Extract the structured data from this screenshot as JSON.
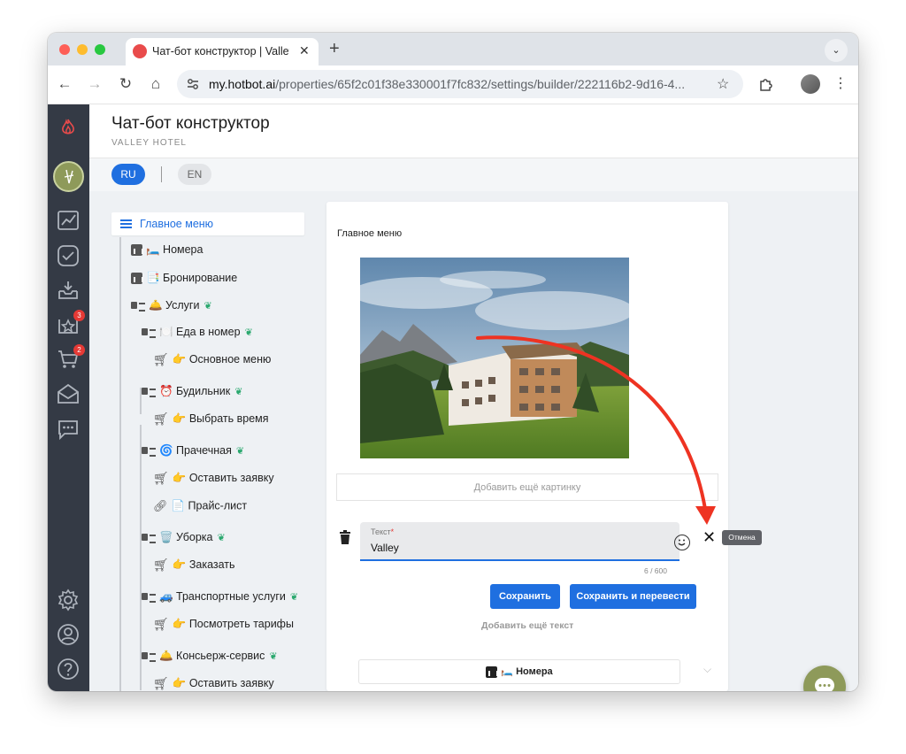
{
  "browser": {
    "tab_title": "Чат-бот конструктор | Valley",
    "url_host": "my.hotbot.ai",
    "url_path": "/properties/65f2c01f38e330001f7fc832/settings/builder/222116b2-9d16-4..."
  },
  "sidebar": {
    "badges": {
      "reviews": "3",
      "cart": "2"
    }
  },
  "header": {
    "title": "Чат-бот конструктор",
    "subtitle": "VALLEY HOTEL"
  },
  "languages": {
    "ru": "RU",
    "en": "EN"
  },
  "tree": {
    "main_menu": "Главное меню",
    "items": [
      {
        "label": "🛏️ Номера"
      },
      {
        "label": "📑 Бронирование"
      },
      {
        "label": "🛎️ Услуги"
      },
      {
        "label": "🍽️ Еда в номер"
      },
      {
        "label": "👉 Основное меню"
      },
      {
        "label": "⏰ Будильник"
      },
      {
        "label": "👉 Выбрать время"
      },
      {
        "label": "🌀 Прачечная"
      },
      {
        "label": "👉 Оставить заявку"
      },
      {
        "label": "📄 Прайс-лист"
      },
      {
        "label": "🗑️ Уборка"
      },
      {
        "label": "👉 Заказать"
      },
      {
        "label": "🚙 Транспортные услуги"
      },
      {
        "label": "👉 Посмотреть тарифы"
      },
      {
        "label": "🛎️ Консьерж-сервис"
      },
      {
        "label": "👉 Оставить заявку"
      }
    ]
  },
  "editor": {
    "section_title": "Главное меню",
    "add_image": "Добавить ещё картинку",
    "text_label": "Текст",
    "text_required": "*",
    "text_value": "Valley",
    "counter": "6 / 600",
    "save": "Сохранить",
    "save_translate": "Сохранить и перевести",
    "add_text": "Добавить ещё текст",
    "next_button": "🛏️ Номера"
  },
  "tooltip": {
    "cancel": "Отмена"
  },
  "colors": {
    "accent": "#1f6fe0",
    "sidebar": "#343a45",
    "brand_olive": "#8e9a5a",
    "annotation_arrow": "#ee3322"
  }
}
